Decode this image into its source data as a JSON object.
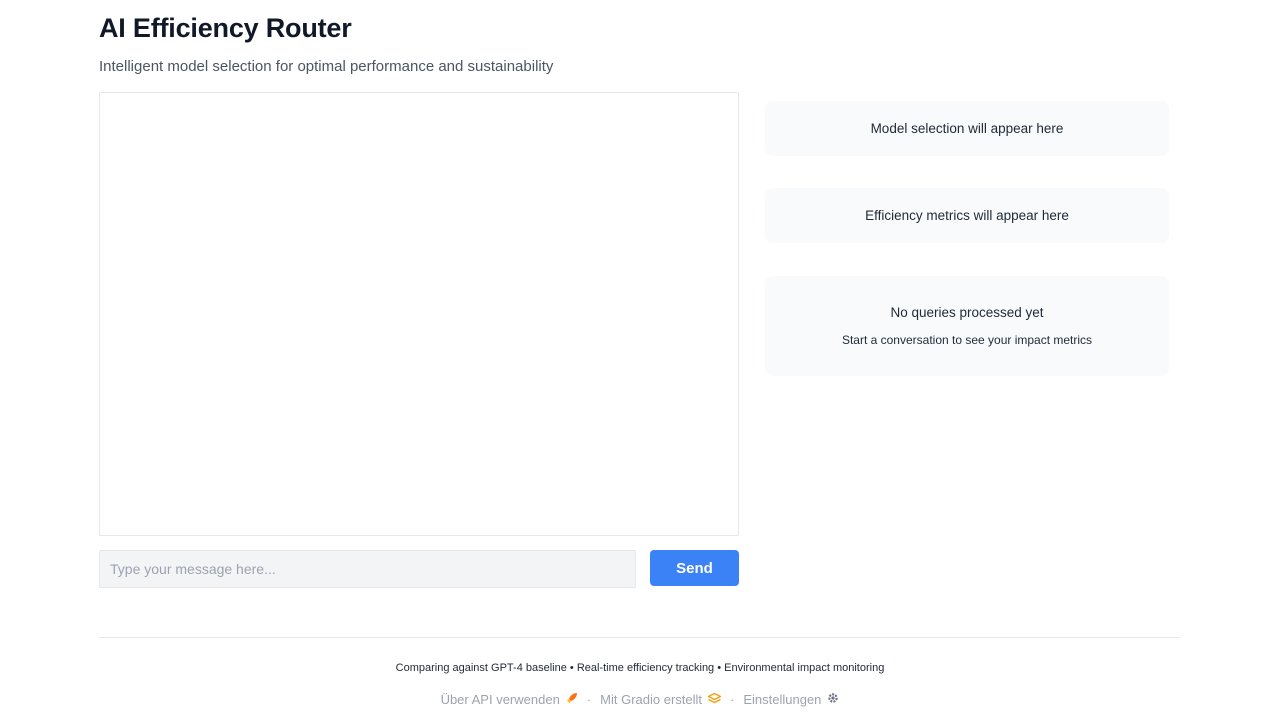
{
  "header": {
    "title": "AI Efficiency Router",
    "subtitle": "Intelligent model selection for optimal performance and sustainability"
  },
  "chat": {
    "input_placeholder": "Type your message here...",
    "input_value": "",
    "send_label": "Send"
  },
  "sidebar": {
    "model_selection_text": "Model selection will appear here",
    "efficiency_metrics_text": "Efficiency metrics will appear here",
    "impact_title": "No queries processed yet",
    "impact_subtitle": "Start a conversation to see your impact metrics"
  },
  "note": "Comparing against GPT-4 baseline • Real-time efficiency tracking • Environmental impact monitoring",
  "footer": {
    "api_label": "Über API verwenden",
    "api_icon": "rocket-icon",
    "built_label": "Mit Gradio erstellt",
    "built_icon": "gradio-logo-icon",
    "settings_label": "Einstellungen",
    "settings_icon": "gear-icon",
    "separator": "·"
  },
  "colors": {
    "accent": "#3b82f6",
    "card_bg": "#f9fafb",
    "input_bg": "#f3f4f6"
  }
}
